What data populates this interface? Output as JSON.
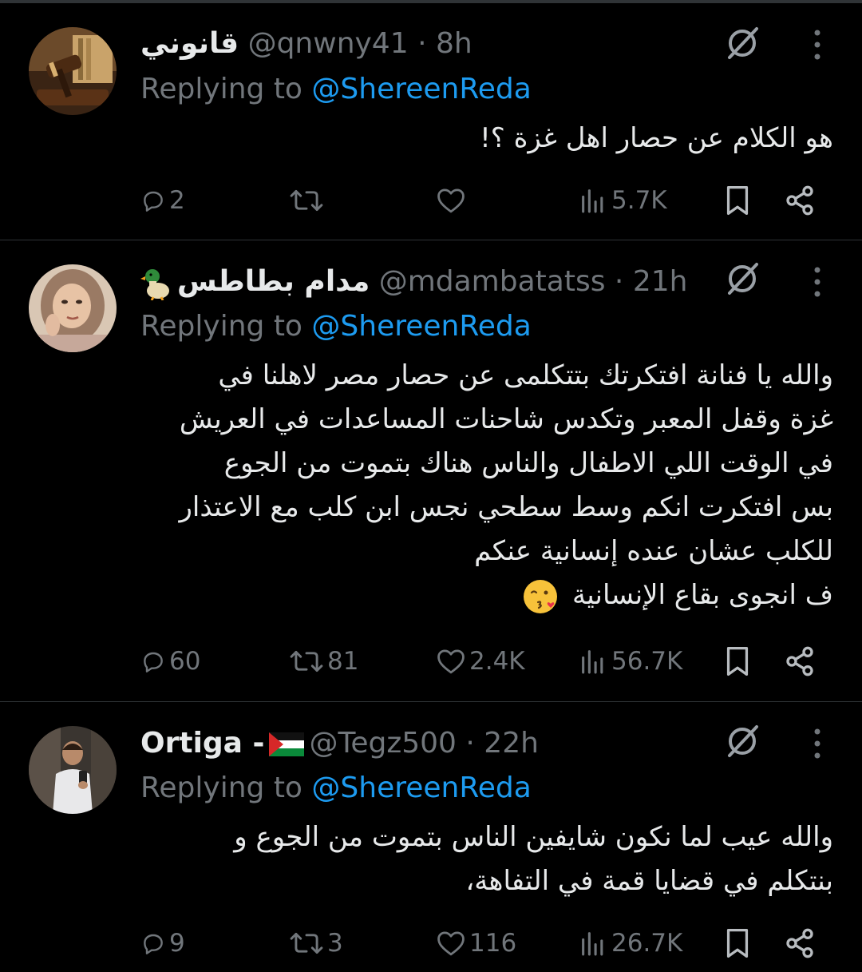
{
  "tweets": [
    {
      "name": "قانوني",
      "handle": "@qnwny41",
      "time": "8h",
      "replying_prefix": "Replying to ",
      "replying_to": "@ShereenReda",
      "lines": [
        "هو الكلام عن حصار اهل غزة ؟!"
      ],
      "replies": "2",
      "reposts": "",
      "likes": "",
      "views": "5.7K",
      "avatar_icon": "gavel-books-avatar"
    },
    {
      "name": "مدام بطاطس",
      "name_emoji": "duck-emoji",
      "handle": "@mdambatatss",
      "time": "21h",
      "replying_prefix": "Replying to ",
      "replying_to": "@ShereenReda",
      "lines": [
        "والله يا فنانة افتكرتك بتتكلمى عن حصار مصر لاهلنا في",
        "غزة وقفل المعبر وتكدس شاحنات المساعدات في العريش",
        "في الوقت اللي الاطفال والناس هناك بتموت من الجوع",
        "بس افتكرت انكم وسط سطحي نجس ابن كلب مع الاعتذار",
        "للكلب عشان عنده إنسانية عنكم",
        "ف انجوى بقاع الإنسانية"
      ],
      "trailing_emoji": "kissing-face-emoji",
      "replies": "60",
      "reposts": "81",
      "likes": "2.4K",
      "views": "56.7K",
      "avatar_icon": "woman-hijab-avatar"
    },
    {
      "name": "Ortiga -",
      "name_emoji": "palestine-flag",
      "handle": "@Tegz500",
      "time": "22h",
      "replying_prefix": "Replying to ",
      "replying_to": "@ShereenReda",
      "lines": [
        "والله عيب لما نكون شايفين الناس بتموت من الجوع و",
        "بنتكلم في قضايا قمة في التفاهة،"
      ],
      "replies": "9",
      "reposts": "3",
      "likes": "116",
      "views": "26.7K",
      "avatar_icon": "man-selfie-avatar"
    }
  ],
  "colors": {
    "background": "#000000",
    "text": "#e7e9ea",
    "muted": "#71767b",
    "mention": "#1d9bf0",
    "divider": "#2f3336"
  }
}
